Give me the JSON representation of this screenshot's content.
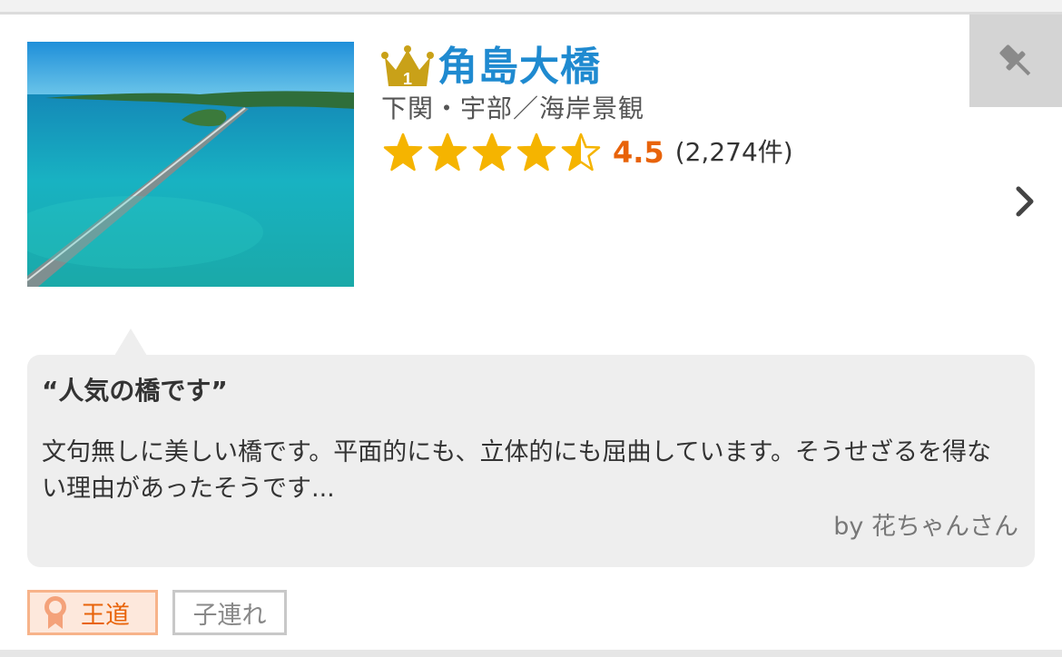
{
  "spot": {
    "rank": "1",
    "title": "角島大橋",
    "category": "下関・宇部／海岸景観",
    "rating": 4.5,
    "score_label": "4.5",
    "review_count_label": "(2,274件)"
  },
  "review": {
    "title": "“人気の橋です”",
    "body": "文句無しに美しい橋です。平面的にも、立体的にも屈曲しています。そうせざるを得ない理由があったそうです...",
    "author": "by 花ちゃんさん"
  },
  "tags": [
    {
      "label": "王道",
      "icon": "award-ribbon-icon"
    },
    {
      "label": "子連れ"
    }
  ],
  "icons": {
    "pin": "pushpin-icon",
    "chevron": "chevron-right-icon",
    "crown": "crown-icon",
    "star": "star-icon"
  },
  "colors": {
    "title": "#1f8ad0",
    "score": "#e8630a",
    "star": "#f5b400",
    "crown": "#c9a118"
  }
}
